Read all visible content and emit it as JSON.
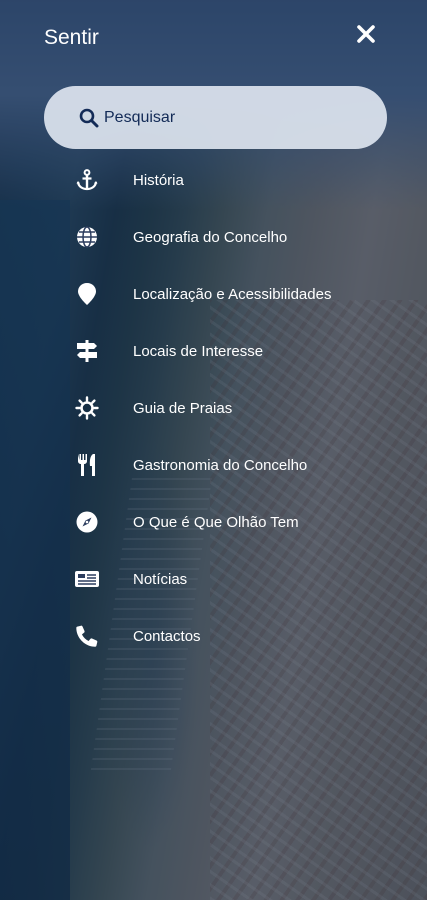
{
  "header": {
    "title": "Sentir",
    "close_icon": "close-icon"
  },
  "search": {
    "placeholder": "Pesquisar",
    "icon": "search-icon",
    "text_color": "#132b57"
  },
  "menu": {
    "items": [
      {
        "label": "História",
        "icon": "anchor-icon"
      },
      {
        "label": "Geografia do Concelho",
        "icon": "globe-icon"
      },
      {
        "label": "Localização e Acessibilidades",
        "icon": "map-pin-icon"
      },
      {
        "label": "Locais de Interesse",
        "icon": "signpost-icon"
      },
      {
        "label": "Guia de Praias",
        "icon": "sun-icon"
      },
      {
        "label": "Gastronomia do Concelho",
        "icon": "utensils-icon"
      },
      {
        "label": "O Que é Que Olhão Tem",
        "icon": "compass-icon"
      },
      {
        "label": "Notícias",
        "icon": "newspaper-icon"
      },
      {
        "label": "Contactos",
        "icon": "phone-icon"
      }
    ]
  },
  "colors": {
    "overlay": "#12203e",
    "text": "#ffffff",
    "search_bg": "#e1e8f2"
  }
}
